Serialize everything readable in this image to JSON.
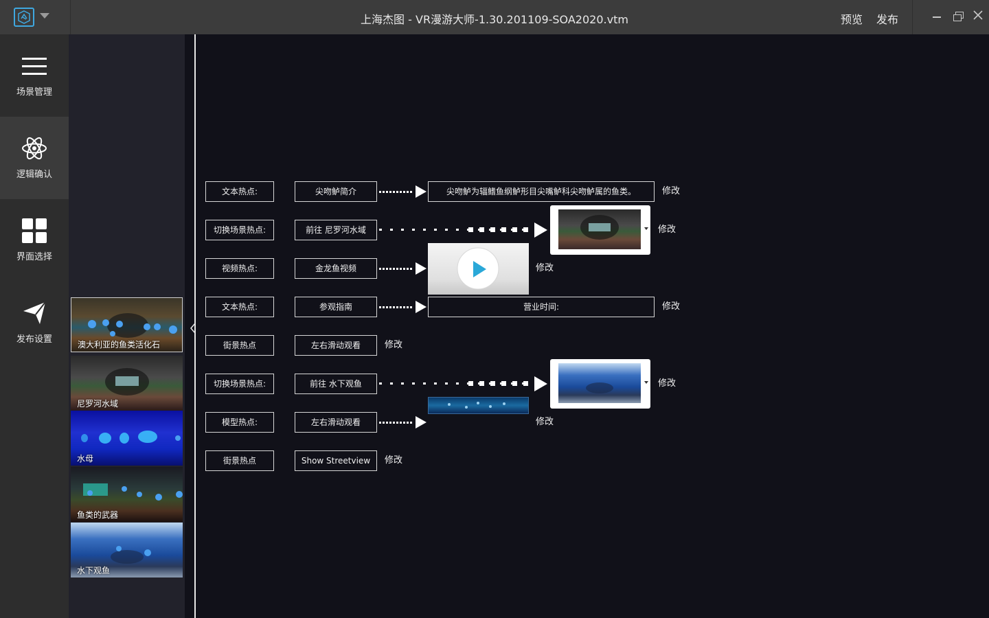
{
  "titlebar": {
    "title": "上海杰图 - VR漫游大师-1.30.201109-SOA2020.vtm",
    "preview": "预览",
    "publish": "发布"
  },
  "nav": {
    "items": [
      {
        "label": "场景管理",
        "icon": "menu-icon"
      },
      {
        "label": "逻辑确认",
        "icon": "atom-icon"
      },
      {
        "label": "界面选择",
        "icon": "grid-icon"
      },
      {
        "label": "发布设置",
        "icon": "send-icon"
      }
    ],
    "active_index": 1
  },
  "scenes": [
    {
      "name": "澳大利亚的鱼类活化石",
      "active": true
    },
    {
      "name": "尼罗河水域",
      "active": false
    },
    {
      "name": "水母",
      "active": false
    },
    {
      "name": "鱼类的武器",
      "active": false
    },
    {
      "name": "水下观鱼",
      "active": false
    }
  ],
  "hotspots": [
    {
      "type": "文本热点:",
      "name": "尖吻鲈简介",
      "target_text": "尖吻鲈为辐鳍鱼纲鲈形目尖嘴鲈科尖吻鲈属的鱼类。",
      "edit": "修改"
    },
    {
      "type": "切换场景热点:",
      "name": "前往 尼罗河水域",
      "edit": "修改"
    },
    {
      "type": "视频热点:",
      "name": "金龙鱼视频",
      "edit": "修改"
    },
    {
      "type": "文本热点:",
      "name": "参观指南",
      "target_text": "营业时间:",
      "edit": "修改"
    },
    {
      "type": "街景热点",
      "name": "左右滑动观看",
      "edit": "修改"
    },
    {
      "type": "切换场景热点:",
      "name": "前往 水下观鱼",
      "edit": "修改"
    },
    {
      "type": "模型热点:",
      "name": "左右滑动观看",
      "edit": "修改"
    },
    {
      "type": "街景热点",
      "name": "Show Streetview",
      "edit": "修改"
    }
  ],
  "colors": {
    "accent": "#3fa8e0",
    "canvas_bg": "#111119",
    "nav_bg": "#2d2d2d",
    "nav_active_bg": "#3b3b3b",
    "titlebar_bg": "#3c3c3c"
  }
}
